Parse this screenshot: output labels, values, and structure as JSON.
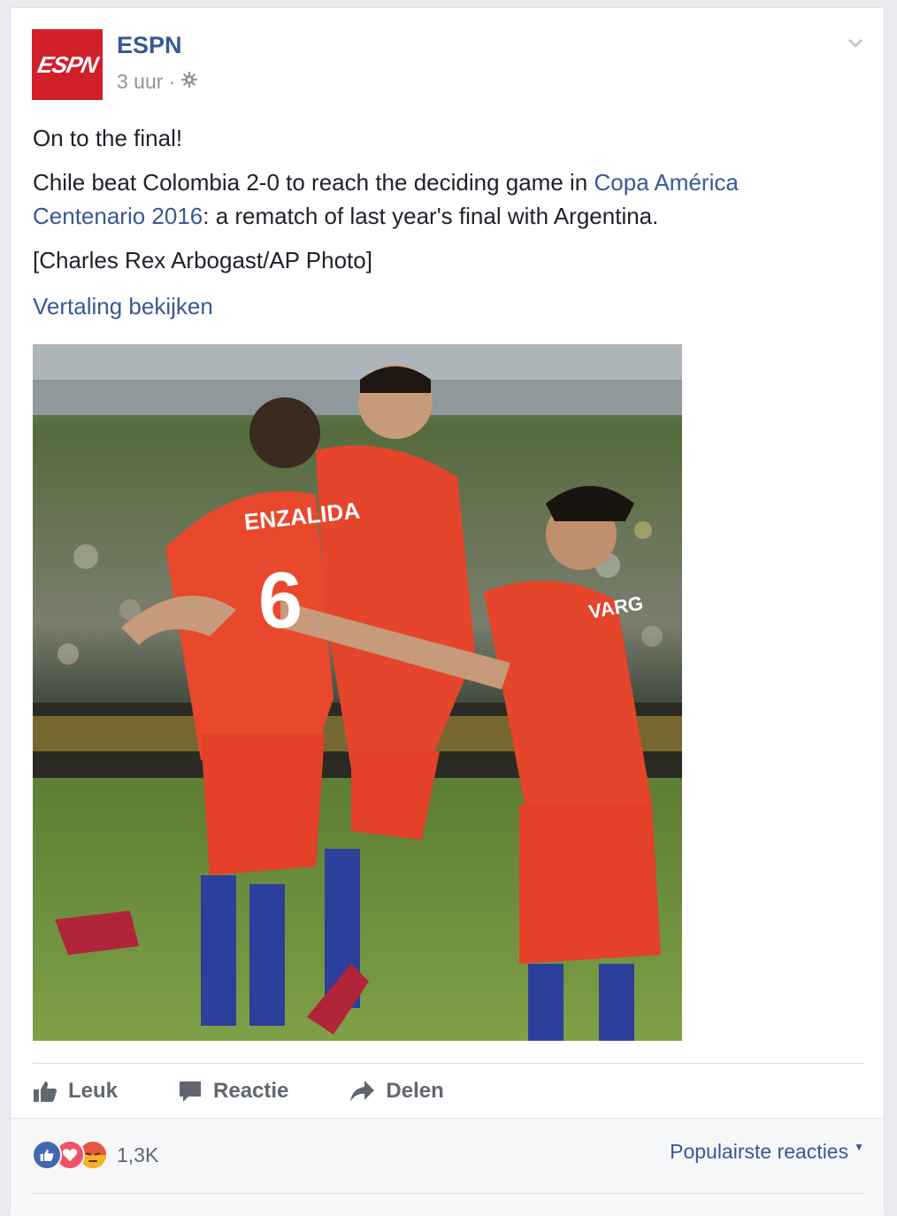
{
  "post": {
    "page_name": "ESPN",
    "avatar_text": "ESPN",
    "time": "3 uur",
    "separator": "·",
    "headline": "On to the final!",
    "body_prefix": "Chile beat Colombia 2-0 to reach the deciding game in ",
    "body_link": "Copa América Centenario 2016",
    "body_suffix": ": a rematch of last year's final with Argentina.",
    "credit": "[Charles Rex Arbogast/AP Photo]",
    "translate_label": "Vertaling bekijken",
    "photo_jersey_1": "ENZALIDA",
    "photo_number_1": "6",
    "photo_jersey_2": "VARG"
  },
  "actions": {
    "like": "Leuk",
    "comment": "Reactie",
    "share": "Delen"
  },
  "footer": {
    "reaction_count": "1,3K",
    "sort_label": "Populairste reacties"
  },
  "colors": {
    "brand_link": "#365899",
    "espn_red": "#d1202a"
  },
  "icons": [
    "chevron-down-icon",
    "gear-icon",
    "thumbs-up-icon",
    "comment-icon",
    "share-icon",
    "like-reaction-icon",
    "love-reaction-icon",
    "angry-reaction-icon"
  ]
}
